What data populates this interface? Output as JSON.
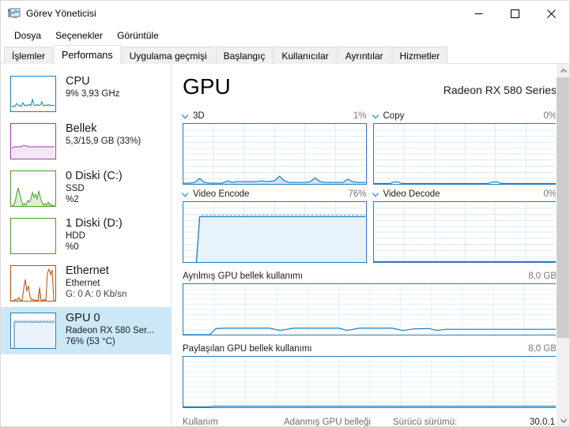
{
  "window": {
    "title": "Görev Yöneticisi",
    "icon": "task-manager-icon",
    "minimize": "–",
    "maximize": "□",
    "close": "✕"
  },
  "menu": {
    "items": [
      {
        "label": "Dosya"
      },
      {
        "label": "Seçenekler"
      },
      {
        "label": "Görüntüle"
      }
    ]
  },
  "tabs": {
    "items": [
      {
        "label": "İşlemler",
        "active": false
      },
      {
        "label": "Performans",
        "active": true
      },
      {
        "label": "Uygulama geçmişi",
        "active": false
      },
      {
        "label": "Başlangıç",
        "active": false
      },
      {
        "label": "Kullanıcılar",
        "active": false
      },
      {
        "label": "Ayrıntılar",
        "active": false
      },
      {
        "label": "Hizmetler",
        "active": false
      }
    ]
  },
  "sidebar": {
    "items": [
      {
        "name": "cpu",
        "title": "CPU",
        "line2": "9%  3,93 GHz",
        "line3": "",
        "color": "#1a7fc1",
        "selected": false
      },
      {
        "name": "memory",
        "title": "Bellek",
        "line2": "5,3/15,9 GB (33%)",
        "line3": "",
        "color": "#a23ab5",
        "selected": false
      },
      {
        "name": "disk-0",
        "title": "0 Diski (C:)",
        "line2": "SSD",
        "line3": "%2",
        "color": "#4a9c2d",
        "selected": false
      },
      {
        "name": "disk-1",
        "title": "1 Diski (D:)",
        "line2": "HDD",
        "line3": "%0",
        "color": "#4a9c2d",
        "selected": false
      },
      {
        "name": "ethernet",
        "title": "Ethernet",
        "line2": "Ethernet",
        "line3": "G: 0 A: 0 Kb/sn",
        "color": "#b5500f",
        "selected": false
      },
      {
        "name": "gpu-0",
        "title": "GPU 0",
        "line2": "Radeon RX 580 Ser...",
        "line3": "76%  (53 °C)",
        "color": "#2a7bb9",
        "selected": true
      }
    ]
  },
  "main": {
    "title": "GPU",
    "device": "Radeon RX 580 Series",
    "engines": [
      {
        "name": "3d",
        "label": "3D",
        "value": "1%"
      },
      {
        "name": "copy",
        "label": "Copy",
        "value": "0%"
      },
      {
        "name": "video-encode",
        "label": "Video Encode",
        "value": "76%"
      },
      {
        "name": "video-decode",
        "label": "Video Decode",
        "value": "0%"
      }
    ],
    "memory_graphs": [
      {
        "name": "dedicated",
        "label": "Ayrılmış GPU bellek kullanımı",
        "max": "8,0 GB"
      },
      {
        "name": "shared",
        "label": "Paylaşılan GPU bellek kullanımı",
        "max": "8,0 GB"
      }
    ],
    "footer": {
      "usage_label": "Kullanım",
      "dedicated_label": "Adanmış GPU belleği",
      "driver_label": "Sürücü sürümü:",
      "driver_value": "30.0.1"
    }
  },
  "chart_data": [
    {
      "name": "3d",
      "type": "area",
      "title": "3D",
      "current": 1,
      "ylim": [
        0,
        100
      ],
      "values": [
        0,
        0,
        1,
        0,
        0,
        3,
        5,
        3,
        0,
        0,
        0,
        0,
        0,
        1,
        2,
        1,
        0,
        0,
        2,
        2,
        2,
        2,
        2,
        2,
        2,
        2,
        2,
        1,
        0,
        0,
        4,
        8,
        4,
        0,
        0,
        0,
        0,
        0,
        1,
        0,
        0,
        0,
        3,
        5,
        3,
        0,
        1,
        0,
        0,
        0,
        0,
        0,
        0,
        2,
        5,
        3,
        1,
        0,
        0,
        0
      ]
    },
    {
      "name": "copy",
      "type": "area",
      "title": "Copy",
      "current": 0,
      "ylim": [
        0,
        100
      ],
      "values": [
        0,
        0,
        0,
        0,
        0,
        0,
        0,
        1,
        2,
        1,
        0,
        0,
        0,
        0,
        0,
        0,
        0,
        0,
        0,
        0,
        0,
        0,
        0,
        0,
        0,
        0,
        0,
        0,
        0,
        0,
        0,
        0,
        0,
        0,
        0,
        0,
        0,
        1,
        2,
        1,
        0,
        0,
        0,
        0,
        0,
        0,
        0,
        0,
        0,
        0,
        0,
        0,
        0,
        0,
        0,
        0,
        0,
        0,
        0,
        0
      ]
    },
    {
      "name": "video-encode",
      "type": "area",
      "title": "Video Encode",
      "current": 76,
      "ylim": [
        0,
        100
      ],
      "values": [
        0,
        0,
        0,
        0,
        0,
        0,
        76,
        77,
        76,
        77,
        76,
        77,
        76,
        77,
        76,
        77,
        76,
        77,
        76,
        77,
        76,
        77,
        76,
        77,
        76,
        77,
        76,
        77,
        76,
        77,
        76,
        77,
        76,
        77,
        76,
        77,
        76,
        77,
        76,
        77,
        76,
        77,
        76,
        77,
        76,
        77,
        76,
        77,
        76,
        77,
        76,
        77,
        76,
        77,
        76,
        77,
        76,
        77,
        76,
        77
      ]
    },
    {
      "name": "video-decode",
      "type": "area",
      "title": "Video Decode",
      "current": 0,
      "ylim": [
        0,
        100
      ],
      "values": [
        0,
        0,
        0,
        0,
        0,
        0,
        0,
        0,
        0,
        0,
        0,
        0,
        0,
        0,
        0,
        0,
        0,
        0,
        0,
        0,
        0,
        0,
        0,
        0,
        0,
        0,
        0,
        0,
        0,
        0,
        0,
        0,
        0,
        0,
        0,
        0,
        0,
        0,
        0,
        0,
        0,
        0,
        0,
        0,
        0,
        0,
        0,
        0,
        0,
        0,
        0,
        0,
        0,
        0,
        0,
        0,
        0,
        0,
        0,
        0
      ]
    },
    {
      "name": "dedicated-memory",
      "type": "line",
      "title": "Ayrılmış GPU bellek kullanımı",
      "ylim": [
        0,
        8
      ],
      "ylabel": "8,0 GB",
      "values": [
        0.0,
        0.0,
        0.0,
        0.0,
        0.1,
        0.6,
        0.7,
        0.7,
        0.7,
        0.7,
        0.7,
        0.7,
        0.7,
        0.7,
        0.7,
        0.7,
        0.6,
        0.55,
        0.6,
        0.65,
        0.7,
        0.7,
        0.7,
        0.7,
        0.7,
        0.7,
        0.7,
        0.7,
        0.6,
        0.55,
        0.6,
        0.7,
        0.7,
        0.7,
        0.7,
        0.7,
        0.7,
        0.6,
        0.5,
        0.45,
        0.45,
        0.5,
        0.55,
        0.5,
        0.5,
        0.5,
        0.5,
        0.5,
        0.5,
        0.5,
        0.5,
        0.5,
        0.5,
        0.5,
        0.5,
        0.5,
        0.5,
        0.5,
        0.5,
        0.5
      ]
    },
    {
      "name": "shared-memory",
      "type": "line",
      "title": "Paylaşılan GPU bellek kullanımı",
      "ylim": [
        0,
        8
      ],
      "ylabel": "8,0 GB",
      "values": [
        0,
        0,
        0,
        0,
        0.05,
        0.08,
        0.08,
        0.08,
        0.08,
        0.08,
        0.08,
        0.08,
        0.08,
        0.08,
        0.08,
        0.08,
        0.08,
        0.08,
        0.08,
        0.08,
        0.08,
        0.08,
        0.08,
        0.08,
        0.08,
        0.08,
        0.08,
        0.08,
        0.08,
        0.08,
        0.08,
        0.08,
        0.08,
        0.08,
        0.08,
        0.08,
        0.08,
        0.08,
        0.08,
        0.08,
        0.08,
        0.08,
        0.08,
        0.08,
        0.08,
        0.08,
        0.08,
        0.08,
        0.08,
        0.08,
        0.08,
        0.08,
        0.08,
        0.08,
        0.08,
        0.08,
        0.08,
        0.08,
        0.08,
        0.08
      ]
    }
  ]
}
